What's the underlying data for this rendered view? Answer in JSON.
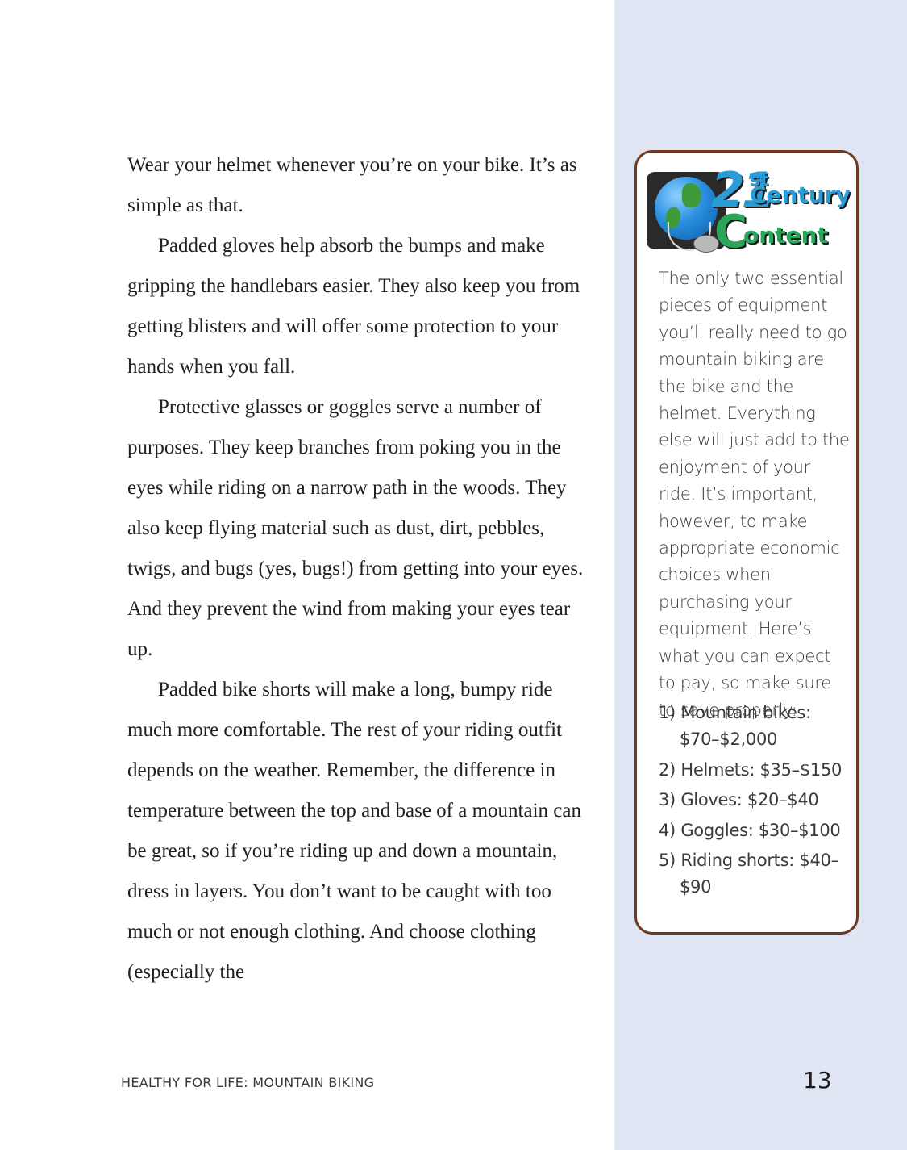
{
  "main": {
    "paragraphs": [
      "Wear your helmet whenever you’re on your bike. It’s as simple as that.",
      "Padded gloves help absorb the bumps and make gripping the handlebars easier. They also keep you from getting blisters and will offer some protection to your hands when you fall.",
      "Protective glasses or goggles serve a number of purposes. They keep branches from poking you in the eyes while riding on a narrow path in the woods. They also keep flying material such as dust, dirt, pebbles, twigs, and bugs (yes, bugs!) from getting into your eyes. And they prevent the wind from making your eyes tear up.",
      "Padded bike shorts will make a long, bumpy ride much more comfortable. The rest of your riding outfit depends on the weather. Remember, the difference in temperature between the top and base of a mountain can be great, so if you’re riding up and down a mountain, dress in layers. You don’t want to be caught with too much or not enough clothing. And choose clothing (especially the"
    ]
  },
  "sidebar": {
    "logo": {
      "number": "21",
      "suffix": "st",
      "word1": "Century",
      "word2_initial": "C",
      "word2_rest": "ontent"
    },
    "body": "The only two essential pieces of equipment you’ll really need to go mountain biking are the bike and the helmet. Everything else will just add to the enjoyment of your ride. It’s important, however, to make appropriate economic choices when purchasing your equipment. Here’s what you can expect to pay, so make sure to save properly:",
    "list": [
      "1) Mountain bikes: $70–$2,000",
      "2) Helmets: $35–$150",
      "3) Gloves: $20–$40",
      "4) Goggles: $30–$100",
      "5) Riding shorts: $40–$90"
    ],
    "border_color": "#6b3a1f"
  },
  "footer": {
    "title": "HEALTHY FOR LIFE: MOUNTAIN BIKING",
    "page_number": "13"
  },
  "colors": {
    "panel_background": "#e0e5f3",
    "logo_blue": "#2b9bd6",
    "logo_green": "#2aa65a"
  }
}
